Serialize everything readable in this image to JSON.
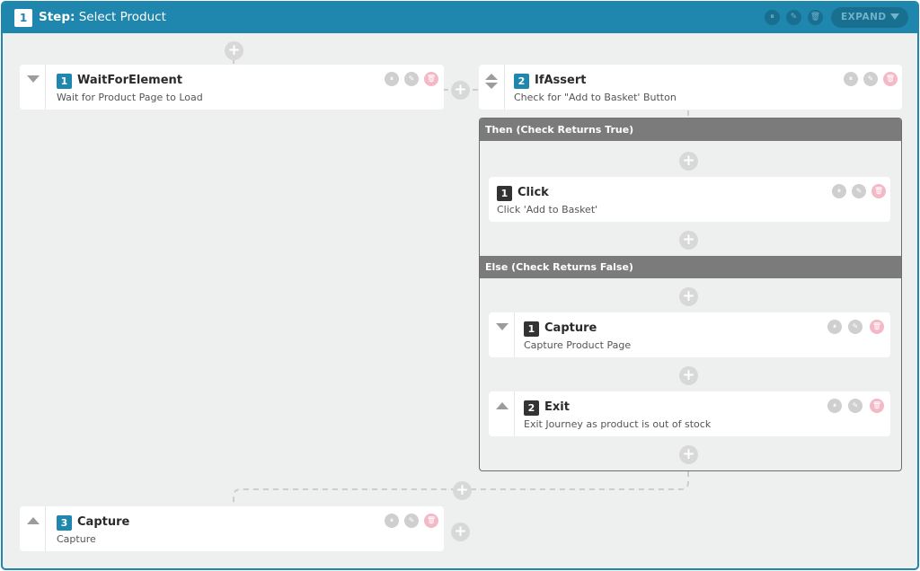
{
  "step": {
    "number": "1",
    "label_prefix": "Step:",
    "label": "Select Product",
    "expand_label": "EXPAND"
  },
  "icons": {
    "pause": "⏸",
    "edit": "✎",
    "delete": "🗑",
    "plus": "+"
  },
  "colors": {
    "accent": "#1f86ad",
    "branch_header": "#7b7b7b",
    "delete": "#f4b9c6",
    "neutral_icon": "#cfcfcf"
  },
  "actions": [
    {
      "number": "1",
      "title": "WaitForElement",
      "subtitle": "Wait for Product Page to Load"
    },
    {
      "number": "2",
      "title": "IfAssert",
      "subtitle": "Check for \"Add to Basket' Button"
    },
    {
      "number": "3",
      "title": "Capture",
      "subtitle": "Capture"
    }
  ],
  "then_branch": {
    "header": "Then (Check Returns True)",
    "actions": [
      {
        "number": "1",
        "title": "Click",
        "subtitle": "Click 'Add to Basket'"
      }
    ]
  },
  "else_branch": {
    "header": "Else (Check Returns False)",
    "actions": [
      {
        "number": "1",
        "title": "Capture",
        "subtitle": "Capture Product Page"
      },
      {
        "number": "2",
        "title": "Exit",
        "subtitle": "Exit Journey as product is out of stock"
      }
    ]
  }
}
